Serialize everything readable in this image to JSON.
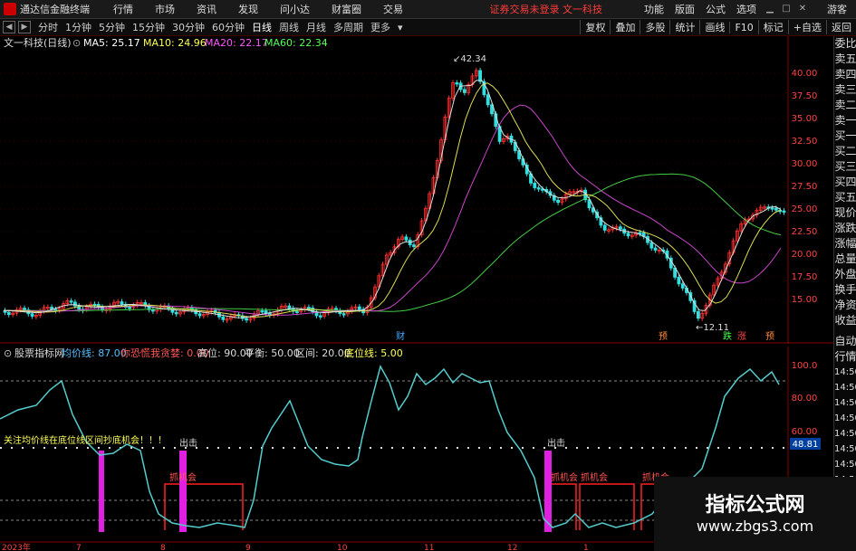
{
  "menubar": {
    "app_name": "通达信金融终端",
    "items": [
      "行情",
      "市场",
      "资讯",
      "发现",
      "问小达",
      "财富圈",
      "交易"
    ],
    "notice": "证券交易未登录  文一科技",
    "right_items": [
      "功能",
      "版面",
      "公式",
      "选项"
    ],
    "guest": "游客"
  },
  "toolbar": {
    "periods": [
      "分时",
      "1分钟",
      "5分钟",
      "15分钟",
      "30分钟",
      "60分钟",
      "日线",
      "周线",
      "月线",
      "多周期",
      "更多"
    ],
    "active_period": "日线",
    "right_buttons": [
      "复权",
      "叠加",
      "多股",
      "统计",
      "画线",
      "F10",
      "标记",
      "+自选",
      "返回"
    ]
  },
  "price_chart": {
    "title": "文一科技(日线)",
    "ma_labels": [
      {
        "text": "MA5: 25.17",
        "color": "#ffffff"
      },
      {
        "text": "MA10: 24.96",
        "color": "#ffff55"
      },
      {
        "text": "MA20: 22.17",
        "color": "#ff55ff"
      },
      {
        "text": "MA60: 22.34",
        "color": "#55ff55"
      }
    ],
    "high_label": "42.34",
    "low_label": "12.11",
    "y_ticks": [
      "40.00",
      "37.50",
      "35.00",
      "32.50",
      "30.00",
      "27.50",
      "25.00",
      "22.50",
      "20.00",
      "17.50",
      "15.00"
    ],
    "markers": [
      {
        "text": "财",
        "color": "#4af"
      },
      {
        "text": "预",
        "color": "#f84"
      },
      {
        "text": "跌",
        "color": "#4f4"
      },
      {
        "text": "涨",
        "color": "#f44"
      },
      {
        "text": "预",
        "color": "#f84"
      }
    ]
  },
  "indicator": {
    "name": "股票指标网",
    "params": [
      {
        "text": "均价线: 87.00",
        "color": "#55c0ff"
      },
      {
        "text": "你恐慌我贪婪: 0.00",
        "color": "#ff5555"
      },
      {
        "text": "高位: 90.00",
        "color": "#dddddd"
      },
      {
        "text": "平衡: 50.00",
        "color": "#dddddd"
      },
      {
        "text": "区间: 20.00",
        "color": "#dddddd"
      },
      {
        "text": "底位线: 5.00",
        "color": "#ffff55"
      }
    ],
    "y_ticks": [
      "100.0",
      "80.00",
      "60.00"
    ],
    "current": "48.81",
    "attention_text": "关注均价线在底位线区间抄底机会！！！",
    "out_labels": [
      "出击",
      "出击"
    ],
    "chance_labels": [
      "抓机会",
      "抓机会",
      "抓机会",
      "抓机会"
    ],
    "x_labels": [
      "2023年",
      "7",
      "8",
      "9",
      "10",
      "11",
      "12",
      "1"
    ]
  },
  "side_panel": {
    "top_items": [
      "委比",
      "卖五",
      "卖四",
      "卖三",
      "卖二",
      "卖一",
      "买一",
      "买二",
      "买三",
      "买四",
      "买五",
      "现价",
      "涨跌",
      "涨幅",
      "总量",
      "外盘",
      "换手",
      "净资",
      "收益"
    ],
    "bottom_items": [
      "自动",
      "行情",
      "14:50",
      "14:50",
      "14:50",
      "14:50",
      "14:50",
      "14:50",
      "14:50",
      "14:50"
    ]
  },
  "watermark": {
    "line1": "指标公式网",
    "line2": "www.zbgs3.com"
  }
}
